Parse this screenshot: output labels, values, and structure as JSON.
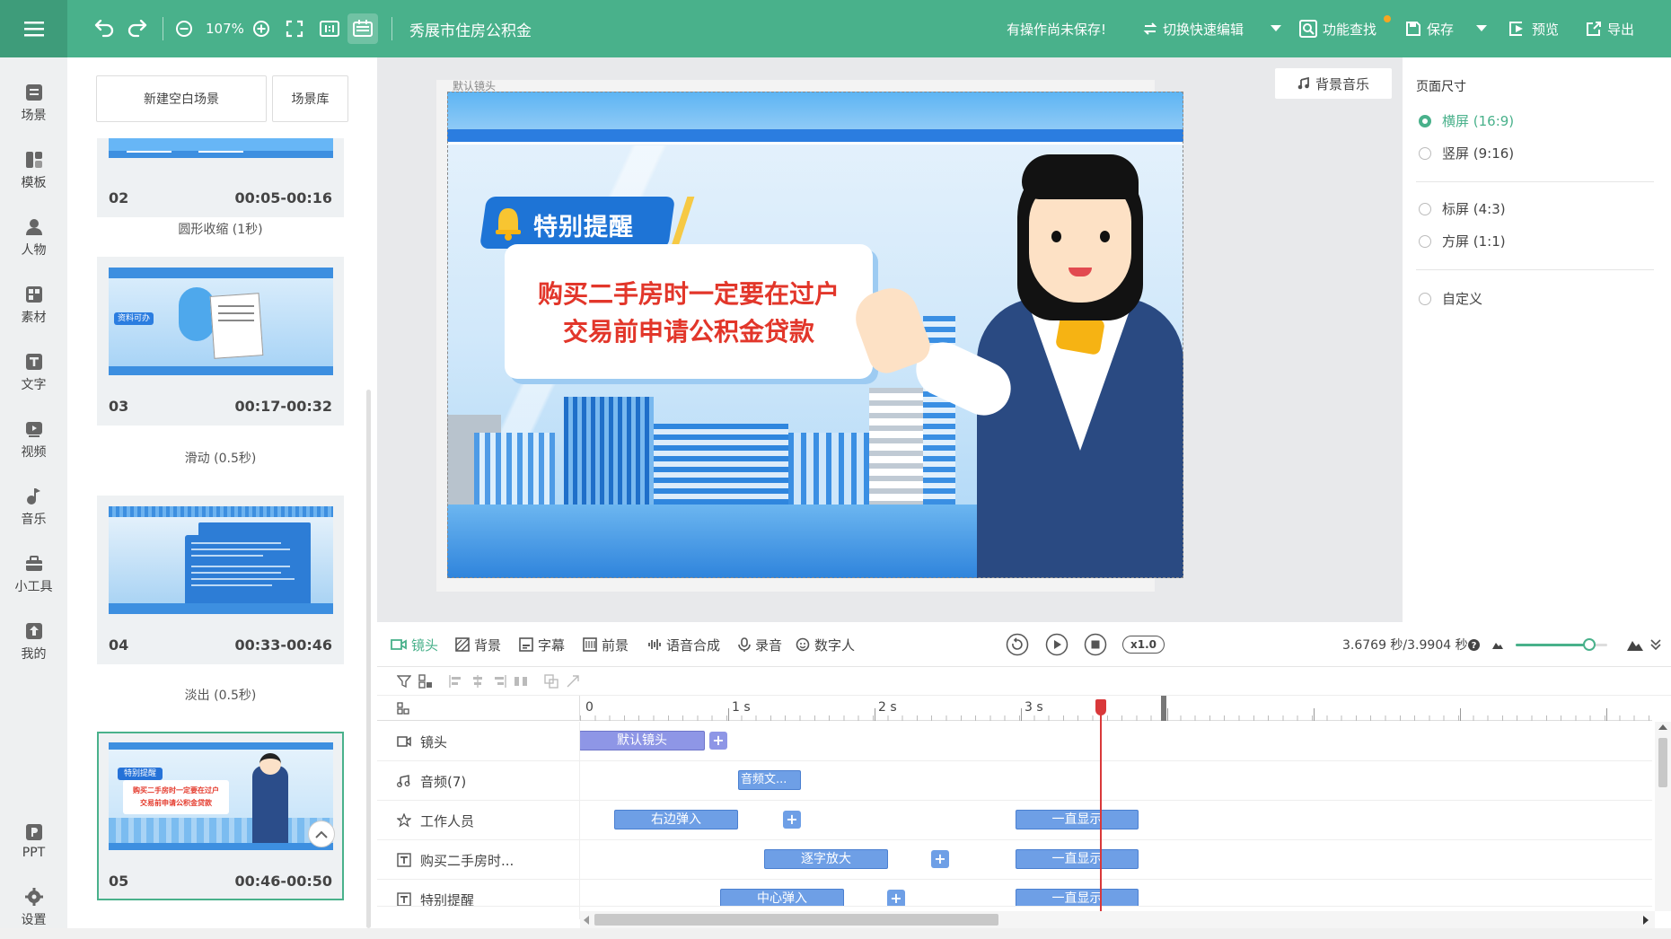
{
  "header": {
    "zoom": "107%",
    "project_title": "秀展市住房公积金",
    "unsaved_notice": "有操作尚未保存!",
    "switch_edit": "切换快速编辑",
    "feature_search": "功能查找",
    "save": "保存",
    "preview": "预览",
    "export": "导出"
  },
  "sidebar": {
    "items": [
      {
        "label": "场景",
        "icon": "scene-icon"
      },
      {
        "label": "模板",
        "icon": "template-icon"
      },
      {
        "label": "人物",
        "icon": "person-icon"
      },
      {
        "label": "素材",
        "icon": "material-icon"
      },
      {
        "label": "文字",
        "icon": "text-icon"
      },
      {
        "label": "视频",
        "icon": "video-icon"
      },
      {
        "label": "音乐",
        "icon": "music-icon"
      },
      {
        "label": "小工具",
        "icon": "toolbox-icon"
      },
      {
        "label": "我的",
        "icon": "my-icon"
      }
    ],
    "bottom_items": [
      {
        "label": "PPT",
        "icon": "ppt-icon"
      },
      {
        "label": "设置",
        "icon": "settings-icon"
      }
    ]
  },
  "scenes_panel": {
    "new_blank": "新建空白场景",
    "library": "场景库",
    "cards": [
      {
        "num": "02",
        "time": "00:05-00:16"
      },
      {
        "num": "03",
        "time": "00:17-00:32"
      },
      {
        "num": "04",
        "time": "00:33-00:46"
      },
      {
        "num": "05",
        "time": "00:46-00:50"
      }
    ],
    "transitions": [
      "圆形收缩 (1秒)",
      "滑动 (0.5秒)",
      "淡出 (0.5秒)"
    ],
    "thumb3_tag": "资料可办",
    "thumb5_title": "特别提醒",
    "thumb5_line1": "购买二手房时一定要在过户",
    "thumb5_line2": "交易前申请公积金贷款"
  },
  "canvas": {
    "camera_label": "默认镜头",
    "bg_music": "背景音乐",
    "banner_title": "特别提醒",
    "headline_line1": "购买二手房时一定要在过户",
    "headline_line2": "交易前申请公积金贷款"
  },
  "page_size": {
    "heading": "页面尺寸",
    "options": [
      "横屏 (16:9)",
      "竖屏 (9:16)",
      "标屏 (4:3)",
      "方屏 (1:1)",
      "自定义"
    ],
    "selected": "横屏 (16:9)"
  },
  "timeline_toolbar": {
    "tabs": [
      "镜头",
      "背景",
      "字幕",
      "前景",
      "语音合成",
      "录音",
      "数字人"
    ],
    "speed": "x1.0",
    "time_readout": "3.6769 秒/3.9904 秒",
    "volume_level": 0.8
  },
  "timeline": {
    "ruler": [
      "0",
      "1 s",
      "2 s",
      "3 s"
    ],
    "tracks": [
      {
        "label": "镜头",
        "clips": [
          "默认镜头"
        ]
      },
      {
        "label": "音频(7)",
        "clips": [
          "音频文..."
        ]
      },
      {
        "label": "工作人员",
        "clips": [
          "右边弹入",
          "一直显示"
        ]
      },
      {
        "label": "购买二手房时...",
        "clips": [
          "逐字放大",
          "一直显示"
        ]
      },
      {
        "label": "特别提醒",
        "clips": [
          "中心弹入",
          "一直显示"
        ]
      }
    ]
  },
  "colors": {
    "brand": "#49b18b",
    "clip_blue": "#6e9fe6",
    "clip_purple": "#8e96e6",
    "playhead": "#d9383a"
  }
}
